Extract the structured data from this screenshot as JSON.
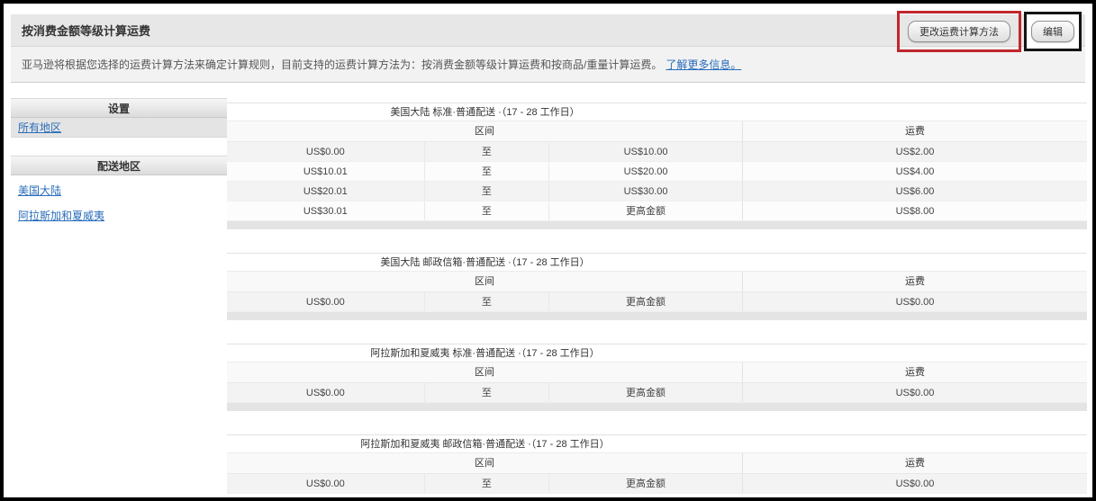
{
  "page": {
    "title": "按消费金额等级计算运费",
    "description": "亚马逊将根据您选择的运费计算方法来确定计算规则，目前支持的运费计算方法为：按消费金额等级计算运费和按商品/重量计算运费。",
    "learn_more_link": "了解更多信息。"
  },
  "toolbar": {
    "change_method_button": "更改运费计算方法",
    "edit_button": "编辑"
  },
  "sidebar": {
    "settings_header": "设置",
    "settings_items": [
      {
        "label": "所有地区",
        "selected": true
      }
    ],
    "regions_header": "配送地区",
    "region_items": [
      {
        "label": "美国大陆"
      },
      {
        "label": "阿拉斯加和夏威夷"
      }
    ]
  },
  "table_headers": {
    "range": "区间",
    "fee": "运费"
  },
  "tables": [
    {
      "title": "美国大陆 标准·普通配送 ·（17 - 28 工作日）",
      "rows": [
        {
          "from": "US$0.00",
          "to": "至",
          "upper": "US$10.00",
          "fee": "US$2.00"
        },
        {
          "from": "US$10.01",
          "to": "至",
          "upper": "US$20.00",
          "fee": "US$4.00"
        },
        {
          "from": "US$20.01",
          "to": "至",
          "upper": "US$30.00",
          "fee": "US$6.00"
        },
        {
          "from": "US$30.01",
          "to": "至",
          "upper": "更高金额",
          "fee": "US$8.00"
        }
      ]
    },
    {
      "title": "美国大陆 邮政信箱·普通配送 ·（17 - 28 工作日）",
      "rows": [
        {
          "from": "US$0.00",
          "to": "至",
          "upper": "更高金额",
          "fee": "US$0.00"
        }
      ]
    },
    {
      "title": "阿拉斯加和夏威夷 标准·普通配送 ·（17 - 28 工作日）",
      "rows": [
        {
          "from": "US$0.00",
          "to": "至",
          "upper": "更高金额",
          "fee": "US$0.00"
        }
      ]
    },
    {
      "title": "阿拉斯加和夏威夷 邮政信箱·普通配送 ·（17 - 28 工作日）",
      "rows": [
        {
          "from": "US$0.00",
          "to": "至",
          "upper": "更高金额",
          "fee": "US$0.00"
        }
      ]
    }
  ],
  "colors": {
    "annotation_red": "#c0272d",
    "annotation_black": "#141414",
    "link": "#2a6ebb"
  }
}
